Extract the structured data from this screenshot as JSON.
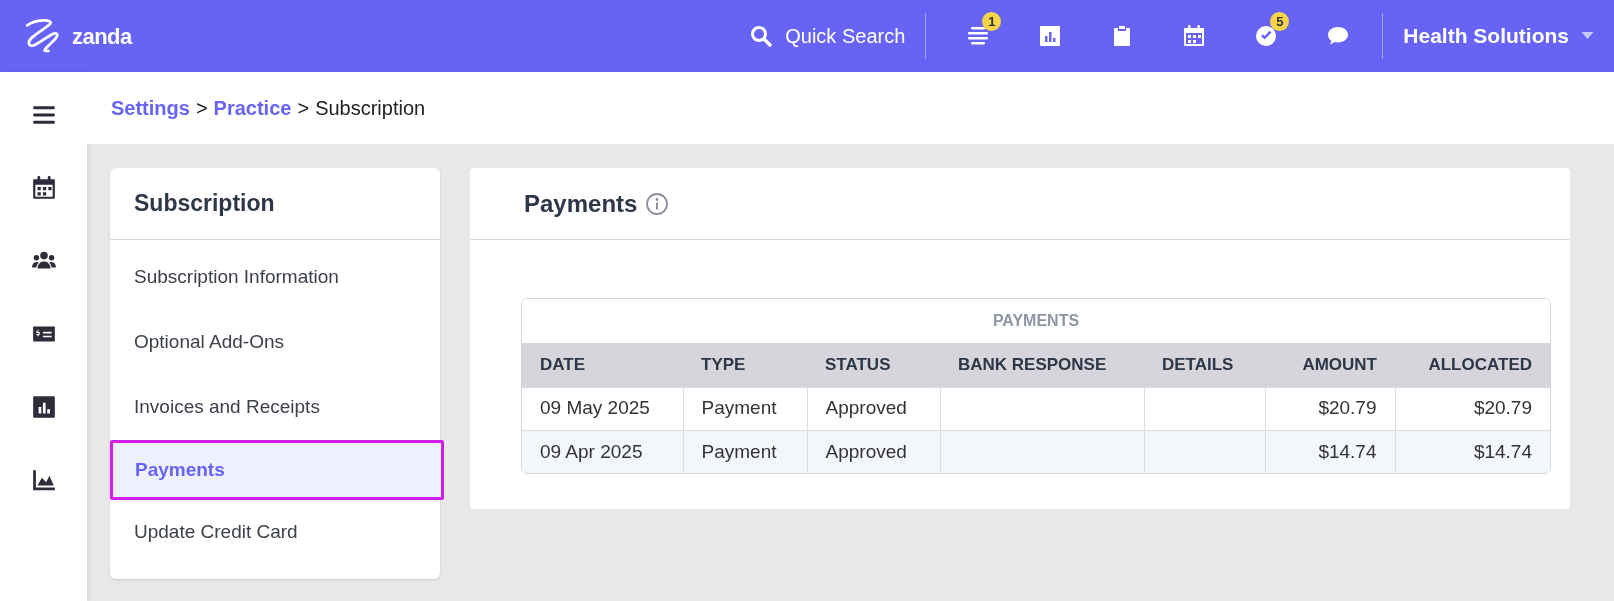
{
  "topbar": {
    "logo": "zanda",
    "search": "Quick Search",
    "icons": [
      {
        "kind": "lines",
        "badge": "1"
      },
      {
        "kind": "chart"
      },
      {
        "kind": "clipboard"
      },
      {
        "kind": "calendar"
      },
      {
        "kind": "check",
        "badge": "5"
      },
      {
        "kind": "chat"
      }
    ],
    "account": "Health Solutions"
  },
  "rail": [
    {
      "kind": "menu"
    },
    {
      "kind": "calendar"
    },
    {
      "kind": "people"
    },
    {
      "kind": "money"
    },
    {
      "kind": "chart"
    },
    {
      "kind": "area"
    }
  ],
  "breadcrumb": [
    {
      "kind": "link",
      "text": "Settings"
    },
    {
      "kind": "separator",
      "text": ">"
    },
    {
      "kind": "link",
      "text": "Practice"
    },
    {
      "kind": "separator",
      "text": ">"
    },
    {
      "kind": "current",
      "text": "Subscription"
    }
  ],
  "sidebar": {
    "title": "Subscription",
    "items": [
      {
        "label": "Subscription Information",
        "selected": false
      },
      {
        "label": "Optional Add-Ons",
        "selected": false
      },
      {
        "label": "Invoices and Receipts",
        "selected": false
      },
      {
        "label": "Payments",
        "selected": true
      },
      {
        "label": "Update Credit Card",
        "selected": false
      }
    ]
  },
  "panel": {
    "title": "Payments",
    "table": {
      "caption": "PAYMENTS",
      "columns": [
        "DATE",
        "TYPE",
        "STATUS",
        "BANK RESPONSE",
        "DETAILS",
        "AMOUNT",
        "ALLOCATED"
      ],
      "rows": [
        [
          "09 May 2025",
          "Payment",
          "Approved",
          "",
          "",
          "$20.79",
          "$20.79"
        ],
        [
          "09 Apr 2025",
          "Payment",
          "Approved",
          "",
          "",
          "$14.74",
          "$14.74"
        ]
      ]
    }
  }
}
